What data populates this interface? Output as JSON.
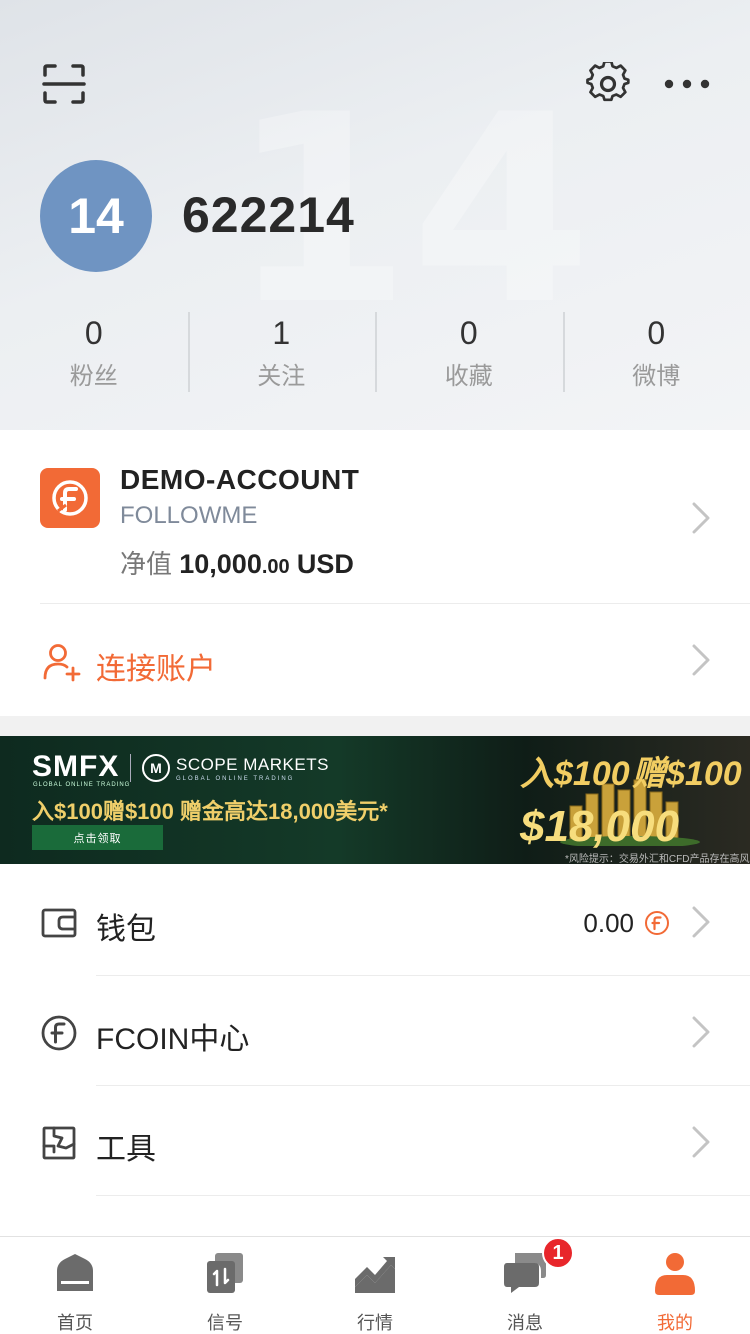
{
  "header": {
    "watermark": "14",
    "avatar_text": "14",
    "username": "622214",
    "stats": [
      {
        "value": "0",
        "label": "粉丝"
      },
      {
        "value": "1",
        "label": "关注"
      },
      {
        "value": "0",
        "label": "收藏"
      },
      {
        "value": "0",
        "label": "微博"
      }
    ],
    "icons": [
      "scan-icon",
      "gear-icon",
      "more-icon"
    ]
  },
  "account": {
    "name": "DEMO-ACCOUNT",
    "broker": "FOLLOWME",
    "equity_label": "净值",
    "equity_int": "10,000",
    "equity_dec": ".00",
    "currency": "USD",
    "connect_label": "连接账户"
  },
  "banner": {
    "brand1": "SMFX",
    "brand1_sub": "GLOBAL ONLINE TRADING",
    "brand2": "SCOPE MARKETS",
    "brand2_sub": "GLOBAL ONLINE TRADING",
    "promo": "入$100赠$100  赠金高达18,000美元*",
    "cta": "点击领取",
    "headline_left": "入$100",
    "headline_right": "赠$100",
    "headline_big": "$18,000",
    "risk": "*风险提示：交易外汇和CFD产品存在高风险"
  },
  "menu": {
    "wallet_label": "钱包",
    "wallet_value": "0.00",
    "fcoin_label": "FCOIN中心",
    "tools_label": "工具"
  },
  "tabbar": {
    "tabs": [
      {
        "label": "首页"
      },
      {
        "label": "信号"
      },
      {
        "label": "行情"
      },
      {
        "label": "消息",
        "badge": "1"
      },
      {
        "label": "我的"
      }
    ]
  },
  "colors": {
    "accent": "#f26a36",
    "avatar": "#6f94c2",
    "badge": "#e8262b"
  }
}
